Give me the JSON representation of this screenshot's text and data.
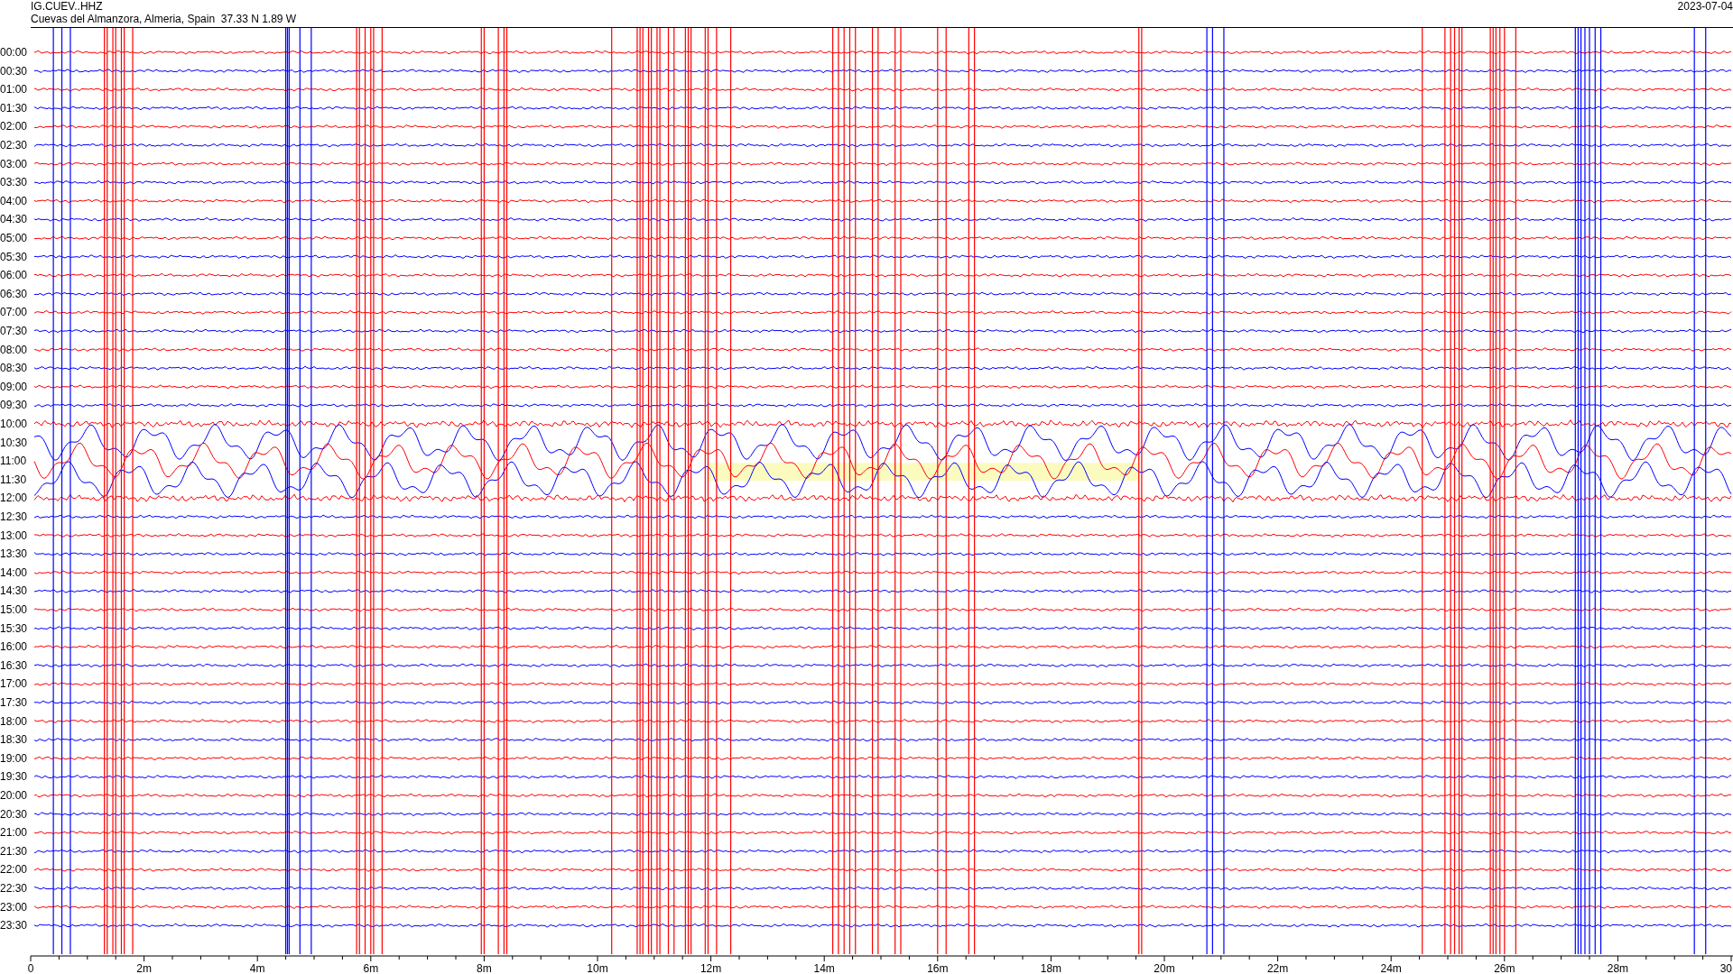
{
  "header": {
    "station": "IG.CUEV..HHZ",
    "location": "Cuevas del Almanzora, Almeria, Spain  37.33 N 1.89 W",
    "date": "2023-07-04"
  },
  "rows": [
    {
      "time": "00:00",
      "color": "#ff0000"
    },
    {
      "time": "00:30",
      "color": "#0000ff"
    },
    {
      "time": "01:00",
      "color": "#ff0000"
    },
    {
      "time": "01:30",
      "color": "#0000ff"
    },
    {
      "time": "02:00",
      "color": "#ff0000"
    },
    {
      "time": "02:30",
      "color": "#0000ff"
    },
    {
      "time": "03:00",
      "color": "#ff0000"
    },
    {
      "time": "03:30",
      "color": "#0000ff"
    },
    {
      "time": "04:00",
      "color": "#ff0000"
    },
    {
      "time": "04:30",
      "color": "#0000ff"
    },
    {
      "time": "05:00",
      "color": "#ff0000"
    },
    {
      "time": "05:30",
      "color": "#0000ff"
    },
    {
      "time": "06:00",
      "color": "#ff0000"
    },
    {
      "time": "06:30",
      "color": "#0000ff"
    },
    {
      "time": "07:00",
      "color": "#ff0000"
    },
    {
      "time": "07:30",
      "color": "#0000ff"
    },
    {
      "time": "08:00",
      "color": "#ff0000"
    },
    {
      "time": "08:30",
      "color": "#0000ff"
    },
    {
      "time": "09:00",
      "color": "#ff0000"
    },
    {
      "time": "09:30",
      "color": "#0000ff"
    },
    {
      "time": "10:00",
      "color": "#ff0000"
    },
    {
      "time": "10:30",
      "color": "#0000ff"
    },
    {
      "time": "11:00",
      "color": "#ff0000"
    },
    {
      "time": "11:30",
      "color": "#0000ff"
    },
    {
      "time": "12:00",
      "color": "#ff0000"
    },
    {
      "time": "12:30",
      "color": "#0000ff"
    },
    {
      "time": "13:00",
      "color": "#ff0000"
    },
    {
      "time": "13:30",
      "color": "#0000ff"
    },
    {
      "time": "14:00",
      "color": "#ff0000"
    },
    {
      "time": "14:30",
      "color": "#0000ff"
    },
    {
      "time": "15:00",
      "color": "#ff0000"
    },
    {
      "time": "15:30",
      "color": "#0000ff"
    },
    {
      "time": "16:00",
      "color": "#ff0000"
    },
    {
      "time": "16:30",
      "color": "#0000ff"
    },
    {
      "time": "17:00",
      "color": "#ff0000"
    },
    {
      "time": "17:30",
      "color": "#0000ff"
    },
    {
      "time": "18:00",
      "color": "#ff0000"
    },
    {
      "time": "18:30",
      "color": "#0000ff"
    },
    {
      "time": "19:00",
      "color": "#ff0000"
    },
    {
      "time": "19:30",
      "color": "#0000ff"
    },
    {
      "time": "20:00",
      "color": "#ff0000"
    },
    {
      "time": "20:30",
      "color": "#0000ff"
    },
    {
      "time": "21:00",
      "color": "#ff0000"
    },
    {
      "time": "21:30",
      "color": "#0000ff"
    },
    {
      "time": "22:00",
      "color": "#ff0000"
    },
    {
      "time": "22:30",
      "color": "#0000ff"
    },
    {
      "time": "23:00",
      "color": "#ff0000"
    },
    {
      "time": "23:30",
      "color": "#0000ff"
    }
  ],
  "x_axis": {
    "labels": [
      "0",
      "2m",
      "4m",
      "6m",
      "8m",
      "10m",
      "12m",
      "14m",
      "16m",
      "18m",
      "20m",
      "22m",
      "24m",
      "26m",
      "28m",
      "30"
    ]
  }
}
